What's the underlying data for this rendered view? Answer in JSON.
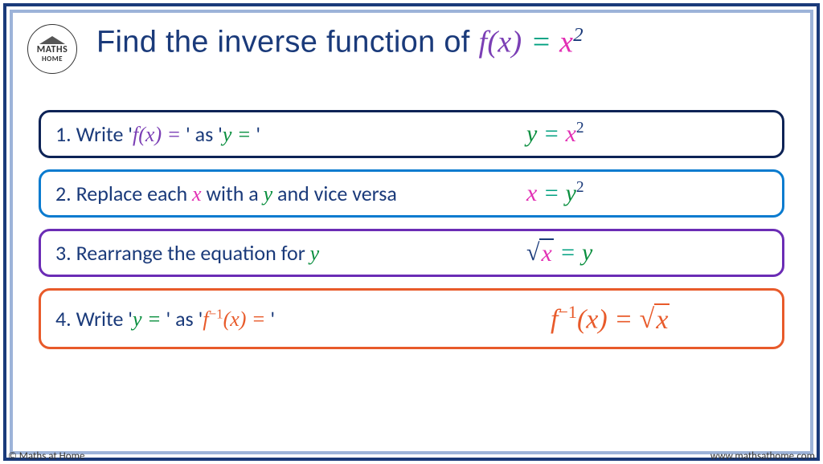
{
  "title": {
    "prefix": "Find the inverse function of ",
    "fx": "f(x)",
    "eq": " = ",
    "x": "x",
    "exp": "2"
  },
  "logo": {
    "line1": "MATHS",
    "line2": "HOME"
  },
  "steps": {
    "s1": {
      "num": "1. ",
      "t1": "Write '",
      "fx": "f(x) =",
      "t2": " ' as '",
      "y": "y =",
      "t3": " '",
      "rhs": {
        "y": "y",
        "eq": " = ",
        "x": "x",
        "exp": "2"
      }
    },
    "s2": {
      "num": "2. ",
      "t1": "Replace each ",
      "x": "x",
      "t2": " with a ",
      "y": "y",
      "t3": " and vice versa",
      "rhs": {
        "x": "x",
        "eq": " = ",
        "y": "y",
        "exp": "2"
      }
    },
    "s3": {
      "num": "3. ",
      "t1": "Rearrange the equation for ",
      "y": "y",
      "rhs": {
        "x": "x",
        "eq": " = ",
        "y": "y"
      }
    },
    "s4": {
      "num": "4. ",
      "t1": "Write '",
      "y": "y =",
      "t2": " ' as '",
      "fi": "f",
      "fiexp": "−1",
      "fix": "(x) =",
      "t3": " '",
      "rhs": {
        "f": "f",
        "exp": "−1",
        "paren": "(x) = ",
        "x": "x"
      }
    }
  },
  "footer": {
    "left": "© Maths at Home",
    "right": "www.mathsathome.com"
  }
}
